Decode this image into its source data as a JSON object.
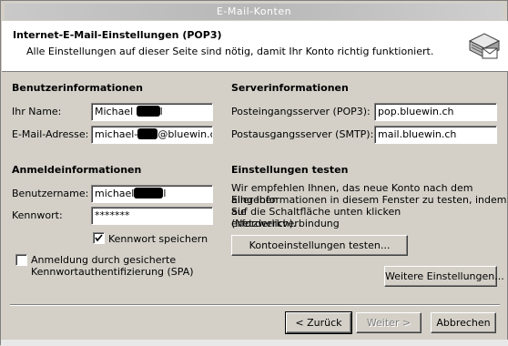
{
  "window": {
    "title": "E-Mail-Konten"
  },
  "header": {
    "title": "Internet-E-Mail-Einstellungen (POP3)",
    "subtitle": "Alle Einstellungen auf dieser Seite sind nötig, damit Ihr Konto richtig funktioniert.",
    "icon": "mail-server-icon"
  },
  "user_info": {
    "heading": "Benutzerinformationen",
    "name_label": "Ihr Name:",
    "name_value_prefix": "Michael",
    "email_label": "E-Mail-Adresse:",
    "email_value_prefix": "michael-",
    "email_value_suffix": "@bluewin.ch"
  },
  "server_info": {
    "heading": "Serverinformationen",
    "incoming_label": "Posteingangsserver (POP3):",
    "incoming_value": "pop.bluewin.ch",
    "outgoing_label": "Postausgangsserver (SMTP):",
    "outgoing_value": "mail.bluewin.ch"
  },
  "login_info": {
    "heading": "Anmeldeinformationen",
    "username_label": "Benutzername:",
    "username_value_prefix": "michael",
    "password_label": "Kennwort:",
    "password_value": "*******",
    "remember_label": "Kennwort speichern",
    "remember_checked": true,
    "spa_label_line1": "Anmeldung durch gesicherte",
    "spa_label_line2": "Kennwortauthentifizierung (SPA)",
    "spa_checked": false
  },
  "test_settings": {
    "heading": "Einstellungen testen",
    "desc_line1": "Wir empfehlen Ihnen, das neue Konto nach dem Eingeben",
    "desc_line2": "aller Informationen in diesem Fenster zu testen, indem Sie",
    "desc_line3": "auf die Schaltfläche unten klicken (Netzwerkverbindung",
    "desc_line4": "erforderlich).",
    "test_button": "Kontoeinstellungen testen..."
  },
  "more_settings_button": "Weitere Einstellungen...",
  "footer": {
    "back": "< Zurück",
    "next": "Weiter >",
    "cancel": "Abbrechen"
  }
}
